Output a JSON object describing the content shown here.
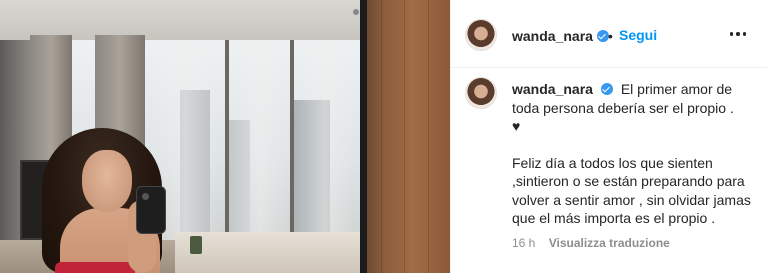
{
  "post": {
    "username": "wanda_nara",
    "follow_label": "Segui",
    "separator": "•",
    "caption": {
      "line1": "El primer amor de toda persona debería ser el propio .",
      "heart": "♥",
      "line2": "Feliz día a todos los que sienten ,sintieron o se están preparando para volver a sentir amor , sin olvidar jamas que el más importa es el propio ."
    },
    "time_ago": "16 h",
    "translate_label": "Visualizza traduzione"
  },
  "icons": {
    "verified": "verified-badge-icon",
    "more": "more-options-icon"
  },
  "colors": {
    "accent": "#0095f6",
    "verified": "#3897f0",
    "text": "#262626",
    "muted": "#8e8e8e"
  }
}
